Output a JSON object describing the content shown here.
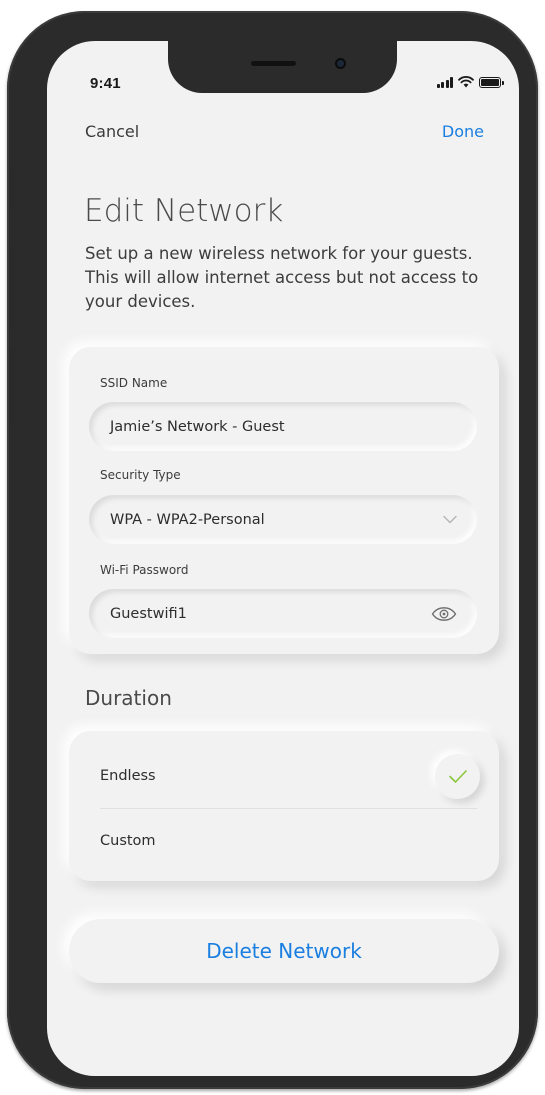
{
  "status_bar": {
    "time": "9:41"
  },
  "nav": {
    "cancel_label": "Cancel",
    "done_label": "Done"
  },
  "page": {
    "title": "Edit Network",
    "description": "Set up a new wireless network for your guests. This will allow internet access but not access to your devices."
  },
  "network": {
    "ssid_label": "SSID Name",
    "ssid_value": "Jamie’s Network - Guest",
    "security_label": "Security Type",
    "security_value": "WPA - WPA2-Personal",
    "password_label": "Wi-Fi Password",
    "password_value": "Guestwifi1"
  },
  "duration": {
    "title": "Duration",
    "options": [
      {
        "label": "Endless",
        "selected": true
      },
      {
        "label": "Custom",
        "selected": false
      }
    ]
  },
  "actions": {
    "delete_label": "Delete Network"
  },
  "icons": {
    "dropdown": "chevron-down-icon",
    "reveal_password": "eye-icon",
    "selected": "checkmark-icon",
    "signal": "cellular-signal-icon",
    "wifi": "wifi-icon",
    "battery": "battery-icon"
  },
  "colors": {
    "accent": "#1a7fe0",
    "check": "#8cc63f",
    "background": "#f2f2f2"
  }
}
